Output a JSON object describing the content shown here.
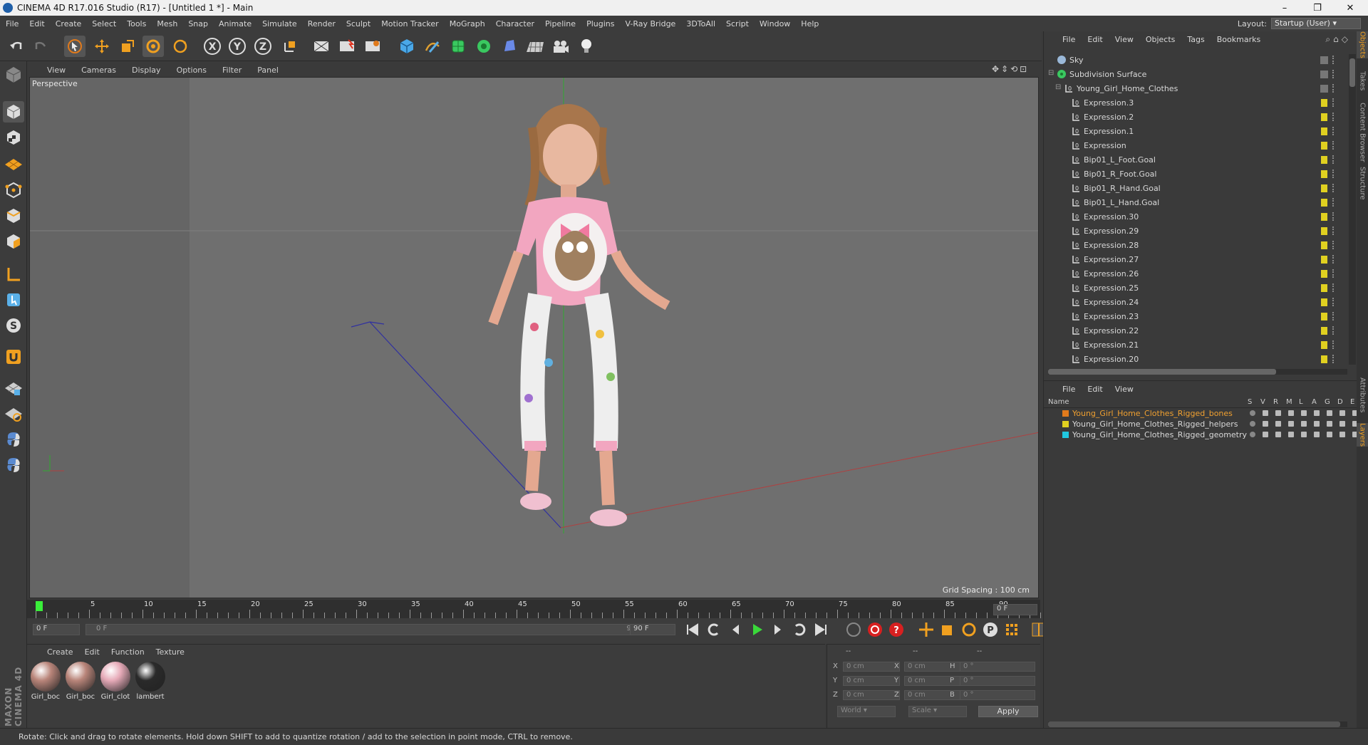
{
  "window": {
    "title": "CINEMA 4D R17.016 Studio (R17) - [Untitled 1 *] - Main",
    "minimize": "–",
    "maximize": "❐",
    "close": "✕"
  },
  "menu": [
    "File",
    "Edit",
    "Create",
    "Select",
    "Tools",
    "Mesh",
    "Snap",
    "Animate",
    "Simulate",
    "Render",
    "Sculpt",
    "Motion Tracker",
    "MoGraph",
    "Character",
    "Pipeline",
    "Plugins",
    "V-Ray Bridge",
    "3DToAll",
    "Script",
    "Window",
    "Help"
  ],
  "layout": {
    "label": "Layout:",
    "value": "Startup (User)"
  },
  "viewport": {
    "menu": [
      "View",
      "Cameras",
      "Display",
      "Options",
      "Filter",
      "Panel"
    ],
    "label": "Perspective",
    "grid_spacing": "Grid Spacing : 100 cm"
  },
  "timeline": {
    "ticks": [
      "0",
      "5",
      "10",
      "15",
      "20",
      "25",
      "30",
      "35",
      "40",
      "45",
      "50",
      "55",
      "60",
      "65",
      "70",
      "75",
      "80",
      "85",
      "90"
    ],
    "frame_readout": "0 F",
    "start_field": "0 F",
    "range_start": "0 F",
    "range_end": "90 F",
    "end_field": "90 F"
  },
  "materials": {
    "menu": [
      "Create",
      "Edit",
      "Function",
      "Texture"
    ],
    "items": [
      {
        "label": "Girl_boc",
        "color": "#b9857a"
      },
      {
        "label": "Girl_boc",
        "color": "#b9857a"
      },
      {
        "label": "Girl_clot",
        "color": "#e6aab8"
      },
      {
        "label": "lambert",
        "color": "#2a2a2a"
      }
    ],
    "brand": "MAXON CINEMA 4D"
  },
  "coords": {
    "headers": [
      "--",
      "--",
      "--"
    ],
    "rows": [
      {
        "a": "X",
        "av": "0 cm",
        "b": "X",
        "bv": "0 cm",
        "c": "H",
        "cv": "0 °"
      },
      {
        "a": "Y",
        "av": "0 cm",
        "b": "Y",
        "bv": "0 cm",
        "c": "P",
        "cv": "0 °"
      },
      {
        "a": "Z",
        "av": "0 cm",
        "b": "Z",
        "bv": "0 cm",
        "c": "B",
        "cv": "0 °"
      }
    ],
    "space": "World",
    "mode": "Scale",
    "apply": "Apply"
  },
  "status": "Rotate: Click and drag to rotate elements. Hold down SHIFT to add to quantize rotation / add to the selection in point mode, CTRL to remove.",
  "objects": {
    "menu": [
      "File",
      "Edit",
      "View",
      "Objects",
      "Tags",
      "Bookmarks"
    ],
    "items": [
      {
        "name": "Sky",
        "type": "sky"
      },
      {
        "name": "Subdivision Surface",
        "type": "subd"
      },
      {
        "name": "Young_Girl_Home_Clothes",
        "type": "null"
      },
      {
        "name": "Expression.3",
        "type": "expr"
      },
      {
        "name": "Expression.2",
        "type": "expr"
      },
      {
        "name": "Expression.1",
        "type": "expr"
      },
      {
        "name": "Expression",
        "type": "expr"
      },
      {
        "name": "Bip01_L_Foot.Goal",
        "type": "expr"
      },
      {
        "name": "Bip01_R_Foot.Goal",
        "type": "expr"
      },
      {
        "name": "Bip01_R_Hand.Goal",
        "type": "expr"
      },
      {
        "name": "Bip01_L_Hand.Goal",
        "type": "expr"
      },
      {
        "name": "Expression.30",
        "type": "expr"
      },
      {
        "name": "Expression.29",
        "type": "expr"
      },
      {
        "name": "Expression.28",
        "type": "expr"
      },
      {
        "name": "Expression.27",
        "type": "expr"
      },
      {
        "name": "Expression.26",
        "type": "expr"
      },
      {
        "name": "Expression.25",
        "type": "expr"
      },
      {
        "name": "Expression.24",
        "type": "expr"
      },
      {
        "name": "Expression.23",
        "type": "expr"
      },
      {
        "name": "Expression.22",
        "type": "expr"
      },
      {
        "name": "Expression.21",
        "type": "expr"
      },
      {
        "name": "Expression.20",
        "type": "expr"
      }
    ]
  },
  "layers": {
    "menu": [
      "File",
      "Edit",
      "View"
    ],
    "columns": [
      "Name",
      "S",
      "V",
      "R",
      "M",
      "L",
      "A",
      "G",
      "D",
      "E"
    ],
    "items": [
      {
        "name": "Young_Girl_Home_Clothes_Rigged_bones",
        "color": "#e07a1c",
        "text_color": "#f0a030"
      },
      {
        "name": "Young_Girl_Home_Clothes_Rigged_helpers",
        "color": "#e0d020",
        "text_color": "#d8d8d8"
      },
      {
        "name": "Young_Girl_Home_Clothes_Rigged_geometry",
        "color": "#20c8e0",
        "text_color": "#d8d8d8"
      }
    ]
  },
  "side_tabs": [
    "Objects",
    "Takes",
    "Content Browser",
    "Structure",
    "Attributes",
    "Layers"
  ]
}
